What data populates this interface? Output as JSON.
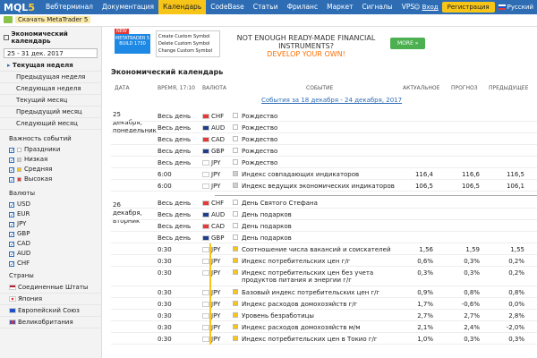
{
  "nav": {
    "logo": "MQL",
    "logo_five": "5",
    "items": [
      "Вебтерминал",
      "Документация",
      "Календарь",
      "CodeBase",
      "Статьи",
      "Фриланс",
      "Маркет",
      "Сигналы",
      "VPS"
    ],
    "login": "Вход",
    "register": "Регистрация",
    "lang": "Русский"
  },
  "subbar": {
    "download": "Скачать MetaTrader 5"
  },
  "banner": {
    "new": "NEW",
    "product": "METATRADER 5",
    "build": "BUILD 1730",
    "menu": [
      "Create Custom Symbol",
      "Delete Custom Symbol",
      "Change Custom Symbol"
    ],
    "headline1": "NOT ENOUGH READY-MADE FINANCIAL INSTRUMENTS?",
    "headline2": "DEVELOP YOUR OWN!",
    "more": "MORE »"
  },
  "sidebar": {
    "title": "Экономический календарь",
    "daterange": "25 - 31 дек. 2017",
    "periods": [
      "Текущая неделя",
      "Предыдущая неделя",
      "Следующая неделя",
      "Текущий месяц",
      "Предыдущий месяц",
      "Следующий месяц"
    ],
    "importance_label": "Важность событий",
    "importance": [
      {
        "label": "Праздники",
        "color": "#ffffff"
      },
      {
        "label": "Низкая",
        "color": "#cfcfcf"
      },
      {
        "label": "Средняя",
        "color": "#f7c518"
      },
      {
        "label": "Высокая",
        "color": "#e53935"
      }
    ],
    "currencies_label": "Валюты",
    "currencies": [
      "USD",
      "EUR",
      "JPY",
      "GBP",
      "CAD",
      "AUD",
      "CHF"
    ],
    "countries_label": "Страны",
    "countries": [
      "Соединенные Штаты",
      "Япония",
      "Европейский Союз",
      "Великобритания"
    ]
  },
  "main": {
    "title": "Экономический календарь",
    "headers": {
      "date": "ДАТА",
      "time": "ВРЕМЯ, 17:10",
      "currency": "ВАЛЮТА",
      "event": "СОБЫТИЕ",
      "actual": "АКТУАЛЬНОЕ",
      "forecast": "ПРОГНОЗ",
      "previous": "ПРЕДЫДУЩЕЕ"
    },
    "week_link": "События за 18 декабря - 24 декабря, 2017",
    "day1": "25 декабря, понедельник",
    "day2": "26 декабря, вторник",
    "events": [
      {
        "time": "Весь день",
        "cur": "CHF",
        "imp": "#ffffff",
        "event": "Рождество",
        "actual": "",
        "forecast": "",
        "previous": ""
      },
      {
        "time": "Весь день",
        "cur": "AUD",
        "imp": "#ffffff",
        "event": "Рождество",
        "actual": "",
        "forecast": "",
        "previous": ""
      },
      {
        "time": "Весь день",
        "cur": "CAD",
        "imp": "#ffffff",
        "event": "Рождество",
        "actual": "",
        "forecast": "",
        "previous": ""
      },
      {
        "time": "Весь день",
        "cur": "GBP",
        "imp": "#ffffff",
        "event": "Рождество",
        "actual": "",
        "forecast": "",
        "previous": ""
      },
      {
        "time": "Весь день",
        "cur": "JPY",
        "imp": "#ffffff",
        "event": "Рождество",
        "actual": "",
        "forecast": "",
        "previous": ""
      },
      {
        "time": "6:00",
        "cur": "JPY",
        "imp": "#cfcfcf",
        "event": "Индекс совпадающих индикаторов",
        "actual": "116,4",
        "forecast": "116,6",
        "previous": "116,5"
      },
      {
        "time": "6:00",
        "cur": "JPY",
        "imp": "#cfcfcf",
        "event": "Индекс ведущих экономических индикаторов",
        "actual": "106,5",
        "forecast": "106,5",
        "previous": "106,1"
      },
      {
        "time": "Весь день",
        "cur": "CHF",
        "imp": "#ffffff",
        "event": "День Святого Стефана",
        "actual": "",
        "forecast": "",
        "previous": ""
      },
      {
        "time": "Весь день",
        "cur": "AUD",
        "imp": "#ffffff",
        "event": "День подарков",
        "actual": "",
        "forecast": "",
        "previous": ""
      },
      {
        "time": "Весь день",
        "cur": "CAD",
        "imp": "#ffffff",
        "event": "День подарков",
        "actual": "",
        "forecast": "",
        "previous": ""
      },
      {
        "time": "Весь день",
        "cur": "GBP",
        "imp": "#ffffff",
        "event": "День подарков",
        "actual": "",
        "forecast": "",
        "previous": ""
      },
      {
        "time": "0:30",
        "cur": "JPY",
        "imp": "#f7c518",
        "event": "Соотношение числа вакансий и соискателей",
        "actual": "1,56",
        "forecast": "1,59",
        "previous": "1,55"
      },
      {
        "time": "0:30",
        "cur": "JPY",
        "imp": "#f7c518",
        "event": "Индекс потребительских цен г/г",
        "actual": "0,6%",
        "forecast": "0,3%",
        "previous": "0,2%"
      },
      {
        "time": "0:30",
        "cur": "JPY",
        "imp": "#f7c518",
        "event": "Индекс потребительских цен без учета продуктов питания и энергии г/г",
        "actual": "0,3%",
        "forecast": "0,3%",
        "previous": "0,2%"
      },
      {
        "time": "0:30",
        "cur": "JPY",
        "imp": "#f7c518",
        "event": "Базовый индекс потребительских цен г/г",
        "actual": "0,9%",
        "forecast": "0,8%",
        "previous": "0,8%"
      },
      {
        "time": "0:30",
        "cur": "JPY",
        "imp": "#f7c518",
        "event": "Индекс расходов домохозяйств г/г",
        "actual": "1,7%",
        "forecast": "-0,6%",
        "previous": "0,0%"
      },
      {
        "time": "0:30",
        "cur": "JPY",
        "imp": "#f7c518",
        "event": "Уровень безработицы",
        "actual": "2,7%",
        "forecast": "2,7%",
        "previous": "2,8%"
      },
      {
        "time": "0:30",
        "cur": "JPY",
        "imp": "#f7c518",
        "event": "Индекс расходов домохозяйств м/м",
        "actual": "2,1%",
        "forecast": "2,4%",
        "previous": "-2,0%"
      },
      {
        "time": "0:30",
        "cur": "JPY",
        "imp": "#f7c518",
        "event": "Индекс потребительских цен в Токио г/г",
        "actual": "1,0%",
        "forecast": "0,3%",
        "previous": "0,3%"
      }
    ]
  },
  "colors": {
    "nav": "#2e6db4",
    "accent": "#f7c518",
    "high": "#e53935",
    "link": "#2e6db4"
  }
}
